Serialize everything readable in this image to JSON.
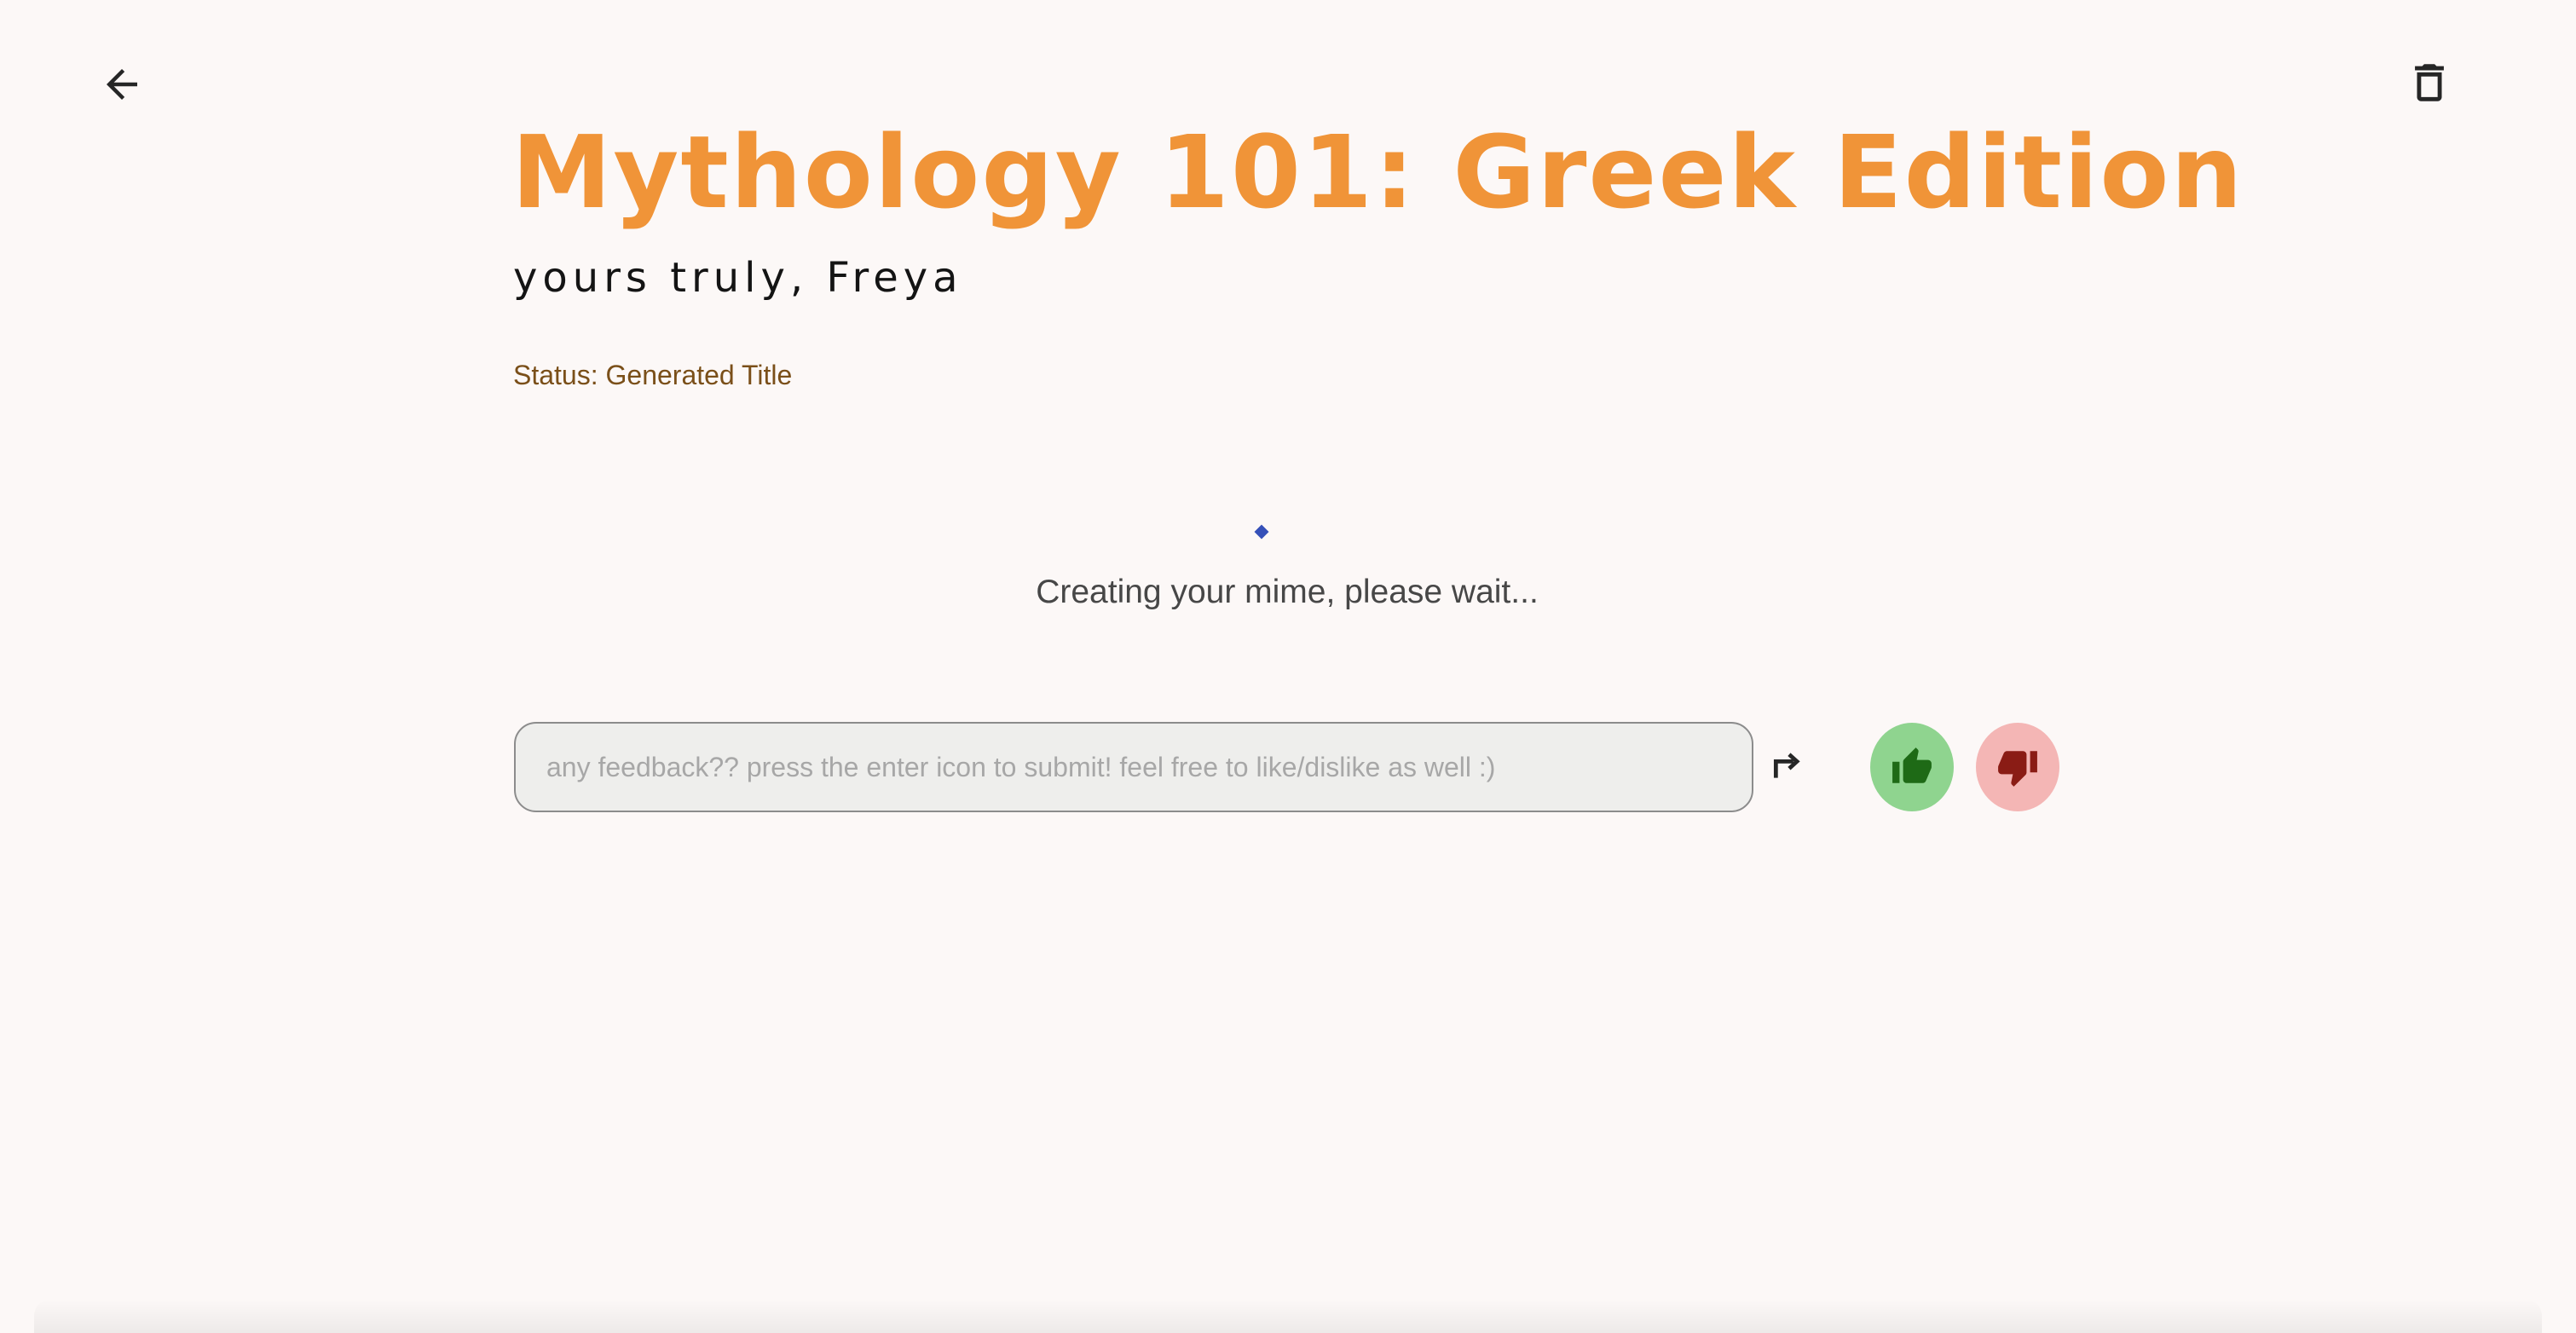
{
  "header": {
    "back_icon": "arrow-left-icon",
    "delete_icon": "trash-icon"
  },
  "mime": {
    "title": "Mythology 101: Greek Edition",
    "subtitle": "yours truly, Freya",
    "status": "Status: Generated Title"
  },
  "loading": {
    "message": "Creating your mime, please wait..."
  },
  "feedback": {
    "placeholder": "any feedback?? press the enter icon to submit! feel free to like/dislike as well :)",
    "value": "",
    "submit_icon": "enter-arrow-icon",
    "like_icon": "thumbs-up-icon",
    "dislike_icon": "thumbs-down-icon"
  },
  "colors": {
    "background": "#fcf8f7",
    "title": "#f09438",
    "status": "#7a4f19",
    "spinner": "#3550b8",
    "like_bg": "#8fd48f",
    "like_icon": "#1e6a16",
    "dislike_bg": "#f4b6b5",
    "dislike_icon": "#8a1c15"
  }
}
